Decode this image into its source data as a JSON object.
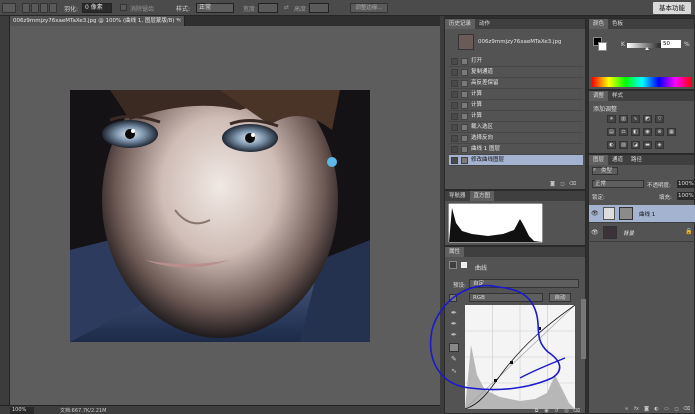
{
  "options_bar": {
    "feather_label": "羽化:",
    "feather_value": "0 像素",
    "antialias_label": "消除锯齿",
    "style_label": "样式:",
    "style_value": "正常",
    "width_label": "宽度:",
    "height_label": "高度:",
    "refine_edge_label": "调整边缘...",
    "workspace_label": "基本功能"
  },
  "document": {
    "tab_title": "006z9mmjzy76xaeMTaXe3.jpg @ 100% (曲线 1, 图层蒙版/8) *",
    "close_symbol": "×",
    "zoom": "100%",
    "doc_info": "文档:667.7K/2.21M"
  },
  "history_panel": {
    "tabs": [
      "历史记录",
      "动作"
    ],
    "snapshot_name": "006z9mmjzy76xaeMTaXe3.jpg",
    "items": [
      "打开",
      "复制通道",
      "高反差保留",
      "计算",
      "计算",
      "计算",
      "载入选区",
      "选择反向",
      "曲线 1 图层",
      "修改曲线图层"
    ],
    "selected_index": 9
  },
  "histogram_panel": {
    "tabs": [
      "导航器",
      "直方图"
    ]
  },
  "properties_panel": {
    "tab": "属性",
    "type_label": "曲线",
    "preset_label": "预设:",
    "preset_value": "自定",
    "channel_value": "RGB",
    "auto_label": "自动"
  },
  "color_panel": {
    "tabs": [
      "颜色",
      "色板"
    ],
    "k_label": "K",
    "k_value": "50",
    "k_percent": "%",
    "k_fraction": 0.5
  },
  "adjustments_panel": {
    "tabs": [
      "调整",
      "样式"
    ],
    "title": "添加调整"
  },
  "layers_panel": {
    "tabs": [
      "图层",
      "通道",
      "路径"
    ],
    "filter_label": "类型",
    "blend_mode": "正常",
    "opacity_label": "不透明度:",
    "opacity_value": "100%",
    "lock_label": "锁定:",
    "fill_label": "填充:",
    "fill_value": "100%",
    "layers": [
      {
        "name": "曲线 1",
        "selected": true
      },
      {
        "name": "背景",
        "selected": false
      }
    ]
  },
  "colors": {
    "selection": "#a4b3cf",
    "annotation": "#1a1acc"
  }
}
